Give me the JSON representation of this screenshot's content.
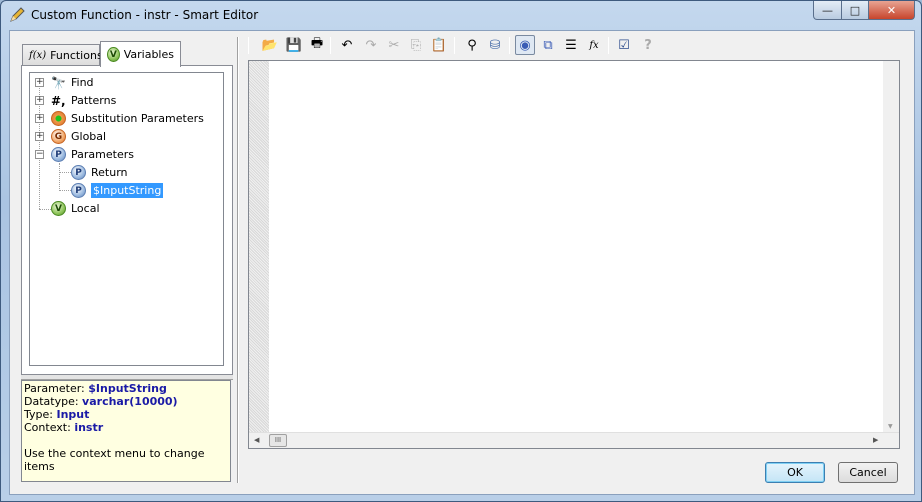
{
  "window": {
    "title": "Custom Function - instr - Smart Editor",
    "minimize": "—",
    "maximize": "□",
    "close": "✕"
  },
  "tabs": [
    {
      "label": "Functions",
      "icon": "f(x)"
    },
    {
      "label": "Variables",
      "icon": "V"
    }
  ],
  "tree": {
    "items": [
      {
        "label": "Find",
        "icon": "binoculars-icon",
        "glyph": "⛓"
      },
      {
        "label": "Patterns",
        "icon": "hash-icon",
        "glyph": "#,"
      },
      {
        "label": "Substitution Parameters",
        "icon": "substitution-icon"
      },
      {
        "label": "Global",
        "icon": "global-icon",
        "glyph": "G"
      },
      {
        "label": "Parameters",
        "icon": "parameter-icon",
        "glyph": "P"
      },
      {
        "label": "Return",
        "icon": "parameter-icon",
        "glyph": "P"
      },
      {
        "label": "$InputString",
        "icon": "parameter-icon",
        "glyph": "P",
        "selected": true
      },
      {
        "label": "Local",
        "icon": "variable-icon",
        "glyph": "V"
      }
    ]
  },
  "info": {
    "parameter_label": "Parameter:",
    "parameter_value": "$InputString",
    "datatype_label": "Datatype:",
    "datatype_value": "varchar(10000)",
    "type_label": "Type:",
    "type_value": "Input",
    "context_label": "Context:",
    "context_value": "instr",
    "hint": "Use the context menu to change items"
  },
  "toolbar": {
    "fx": "fx"
  },
  "buttons": {
    "ok": "OK",
    "cancel": "Cancel"
  },
  "scrollbar": {
    "thumb": "III"
  }
}
